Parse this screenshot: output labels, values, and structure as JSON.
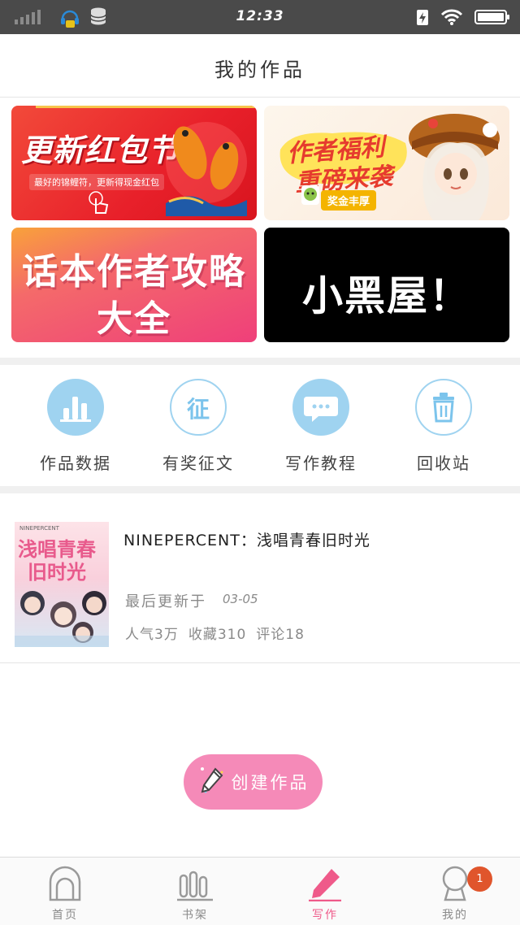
{
  "status_bar": {
    "time": "12:33"
  },
  "header": {
    "title": "我的作品"
  },
  "banners": [
    {
      "title": "更新红包节",
      "subtitle": "最好的锦鲤符，更新得现金红包"
    },
    {
      "title_line1": "作者福利",
      "title_line2": "重磅来袭",
      "tag": "奖金丰厚"
    },
    {
      "title_line1": "话本作者攻略",
      "title_line2": "大全"
    },
    {
      "title": "小黑屋！"
    }
  ],
  "quick_entries": [
    {
      "label": "作品数据",
      "icon": "bar-chart-icon",
      "icon_text": ""
    },
    {
      "label": "有奖征文",
      "icon": "contest-icon",
      "icon_text": "征"
    },
    {
      "label": "写作教程",
      "icon": "chat-bubble-icon",
      "icon_text": ""
    },
    {
      "label": "回收站",
      "icon": "trash-icon",
      "icon_text": ""
    }
  ],
  "work": {
    "title": "NINEPERCENT：浅唱青春旧时光",
    "cover_en": "NINEPERCENT",
    "cover_zh_line1": "浅唱青春",
    "cover_zh_line2": "旧时光",
    "updated_label": "最后更新于",
    "updated_date": "03-05",
    "stats": [
      "人气3万",
      "收藏310",
      "评论18"
    ]
  },
  "create_button": {
    "label": "创建作品"
  },
  "tab_bar": {
    "items": [
      {
        "label": "首页",
        "icon": "home-icon"
      },
      {
        "label": "书架",
        "icon": "bookshelf-icon"
      },
      {
        "label": "写作",
        "icon": "pen-icon"
      },
      {
        "label": "我的",
        "icon": "profile-icon"
      }
    ],
    "active_index": 2,
    "badge_count": "1"
  },
  "colors": {
    "accent_pink": "#ef5a8a",
    "icon_blue": "#9fd3f0",
    "button_pink": "#f58ab8",
    "badge_orange": "#e0552c"
  }
}
